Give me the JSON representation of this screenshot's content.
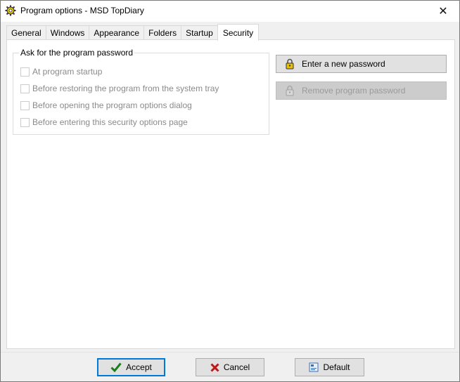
{
  "window": {
    "title": "Program options - MSD TopDiary",
    "close_label": "✕"
  },
  "tabs": [
    {
      "label": "General",
      "active": false
    },
    {
      "label": "Windows",
      "active": false
    },
    {
      "label": "Appearance",
      "active": false
    },
    {
      "label": "Folders",
      "active": false
    },
    {
      "label": "Startup",
      "active": false
    },
    {
      "label": "Security",
      "active": true
    }
  ],
  "security": {
    "group_title": "Ask for the program password",
    "options": [
      {
        "label": "At program startup",
        "checked": false,
        "enabled": false
      },
      {
        "label": "Before restoring the program from the system tray",
        "checked": false,
        "enabled": false
      },
      {
        "label": "Before opening the program options dialog",
        "checked": false,
        "enabled": false
      },
      {
        "label": "Before entering this security options page",
        "checked": false,
        "enabled": false
      }
    ],
    "enter_password_label": "Enter a new password",
    "remove_password_label": "Remove program password"
  },
  "footer": {
    "accept_label": "Accept",
    "cancel_label": "Cancel",
    "default_label": "Default"
  },
  "colors": {
    "accept_icon": "#1a7f1a",
    "cancel_icon": "#c01818",
    "focus_border": "#0078d7"
  }
}
